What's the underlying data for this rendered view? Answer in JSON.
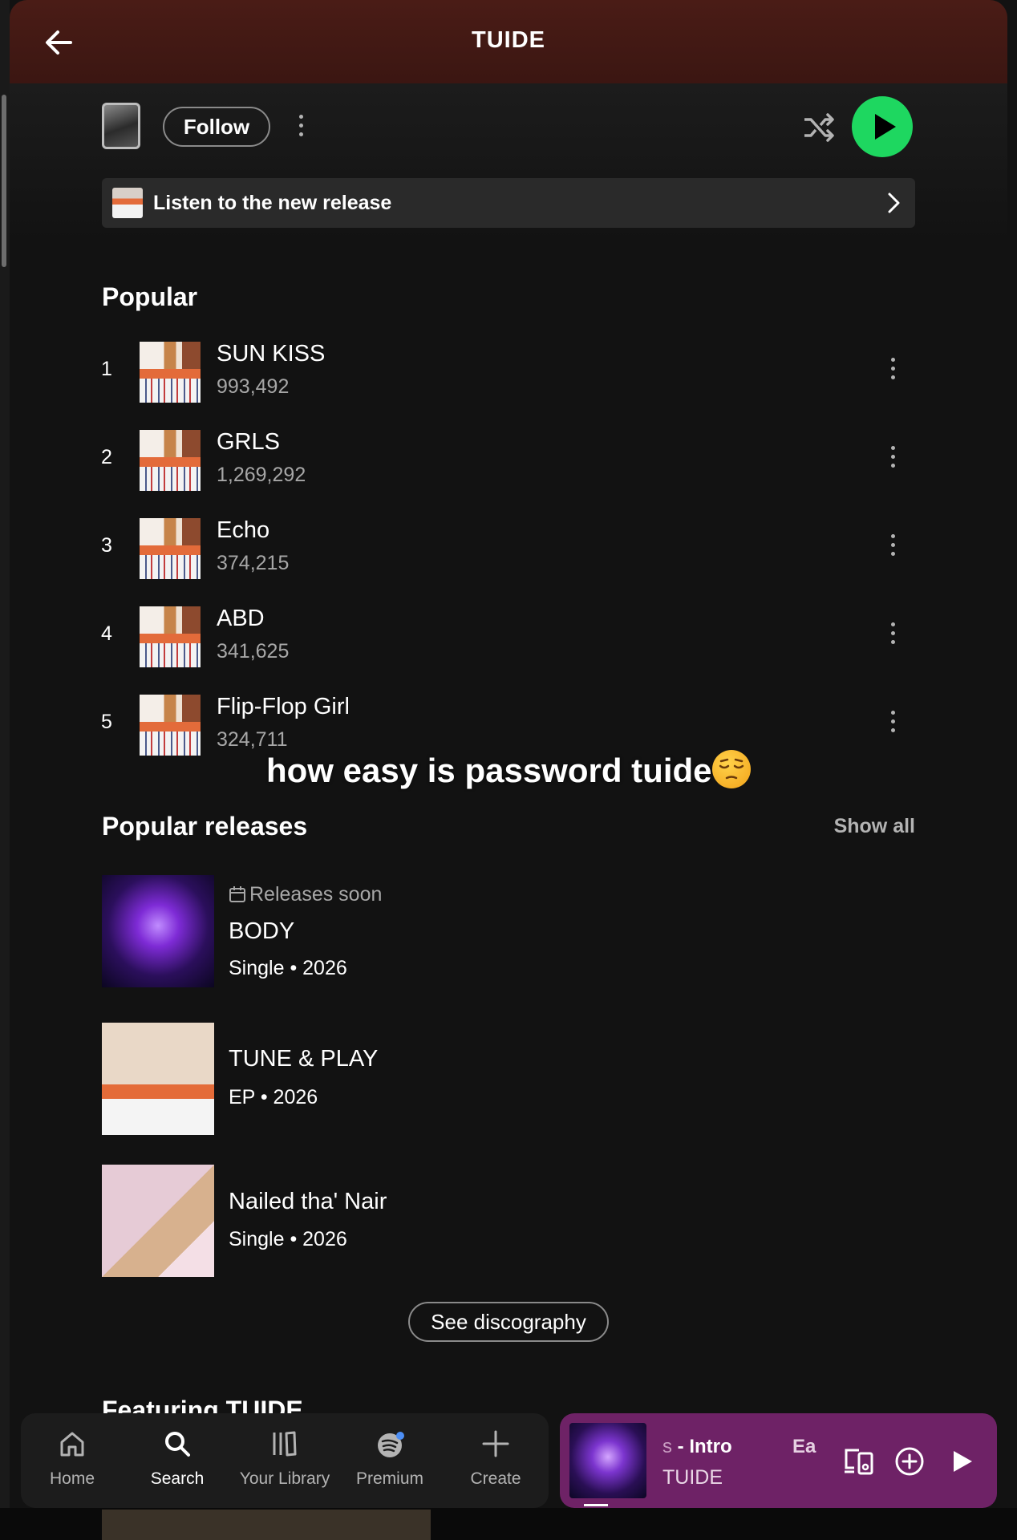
{
  "header": {
    "title": "TUIDE"
  },
  "controls": {
    "follow_label": "Follow"
  },
  "banner": {
    "label": "Listen to the new release"
  },
  "popular": {
    "title": "Popular",
    "tracks": [
      {
        "num": "1",
        "title": "SUN KISS",
        "plays": "993,492"
      },
      {
        "num": "2",
        "title": "GRLS",
        "plays": "1,269,292"
      },
      {
        "num": "3",
        "title": "Echo",
        "plays": "374,215"
      },
      {
        "num": "4",
        "title": "ABD",
        "plays": "341,625"
      },
      {
        "num": "5",
        "title": "Flip-Flop Girl",
        "plays": "324,711"
      }
    ]
  },
  "overlay": {
    "caption": "how easy is password tuide"
  },
  "popular_releases": {
    "title": "Popular releases",
    "show_all": "Show all",
    "items": [
      {
        "badge": "Releases soon",
        "title": "BODY",
        "meta": "Single • 2026"
      },
      {
        "title": "TUNE & PLAY",
        "meta": "EP • 2026"
      },
      {
        "title": "Nailed tha' Nair",
        "meta": "Single • 2026"
      }
    ]
  },
  "discography_label": "See discography",
  "featuring_title": "Featuring TUIDE",
  "nav": {
    "items": [
      {
        "label": "Home",
        "icon": "home-icon"
      },
      {
        "label": "Search",
        "icon": "search-icon",
        "active": true
      },
      {
        "label": "Your Library",
        "icon": "library-icon"
      },
      {
        "label": "Premium",
        "icon": "premium-icon"
      },
      {
        "label": "Create",
        "icon": "plus-icon"
      }
    ]
  },
  "mini_player": {
    "title_fade": "s",
    "title": " - Intro",
    "next_title": "Ea",
    "artist": "TUIDE"
  },
  "colors": {
    "accent_green": "#1ed760",
    "header_bg": "#4a1c16",
    "mini_player_bg": "#6e2266",
    "background": "#121212"
  }
}
